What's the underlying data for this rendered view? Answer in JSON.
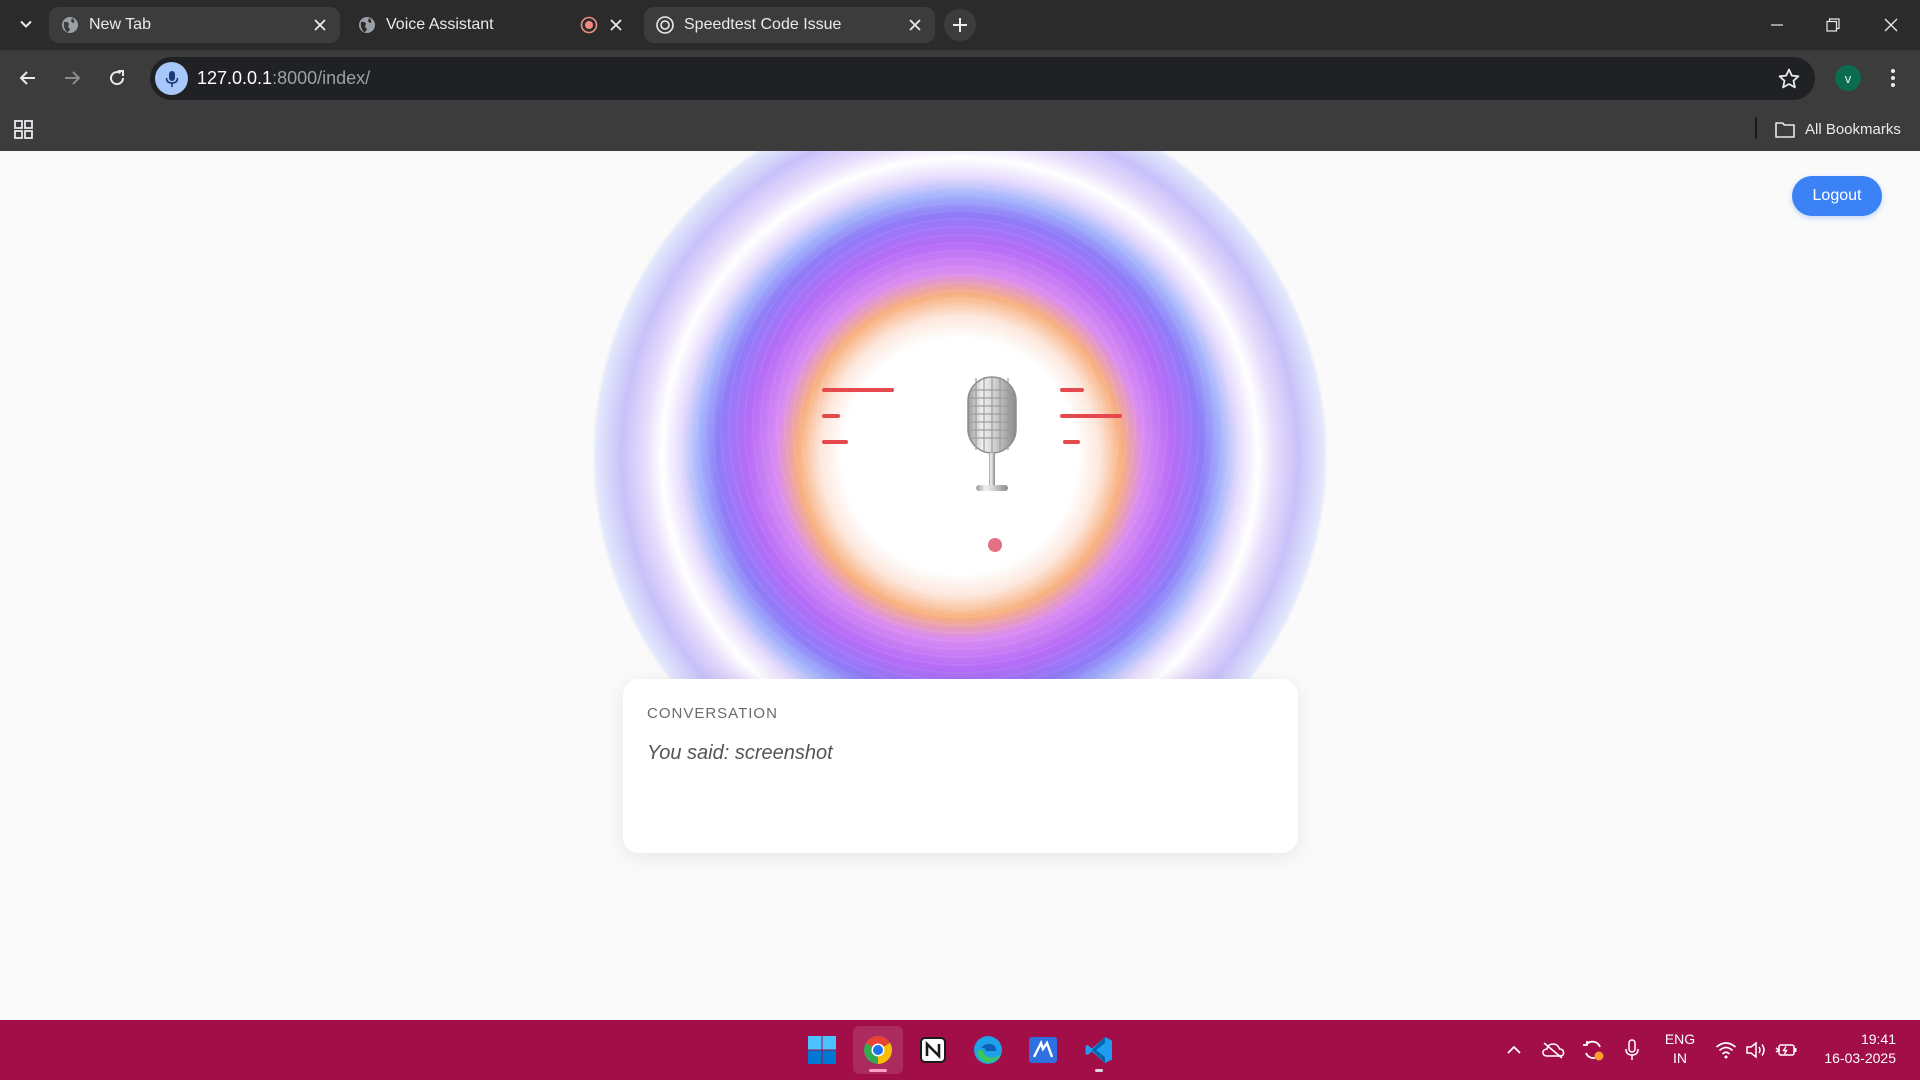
{
  "browser": {
    "tabs": [
      {
        "title": "New Tab",
        "icon": "globe-icon",
        "state": "inactive"
      },
      {
        "title": "Voice Assistant",
        "icon": "globe-icon",
        "state": "inactive",
        "recording": true
      },
      {
        "title": "Speedtest Code Issue",
        "icon": "openai-icon",
        "state": "active"
      }
    ],
    "url_host": "127.0.0.1",
    "url_path": ":8000/index/",
    "profile_initial": "v",
    "bookmarks_label": "All Bookmarks"
  },
  "page": {
    "logout_label": "Logout",
    "conversation": {
      "heading": "CONVERSATION",
      "text": "You said: screenshot"
    },
    "accent_color": "#3b82f6"
  },
  "taskbar": {
    "apps": [
      "windows-start-icon",
      "chrome-icon",
      "notion-icon",
      "edge-icon",
      "app-icon",
      "vscode-icon"
    ],
    "language_line1": "ENG",
    "language_line2": "IN",
    "time": "19:41",
    "date": "16-03-2025",
    "color": "#a10e48"
  }
}
